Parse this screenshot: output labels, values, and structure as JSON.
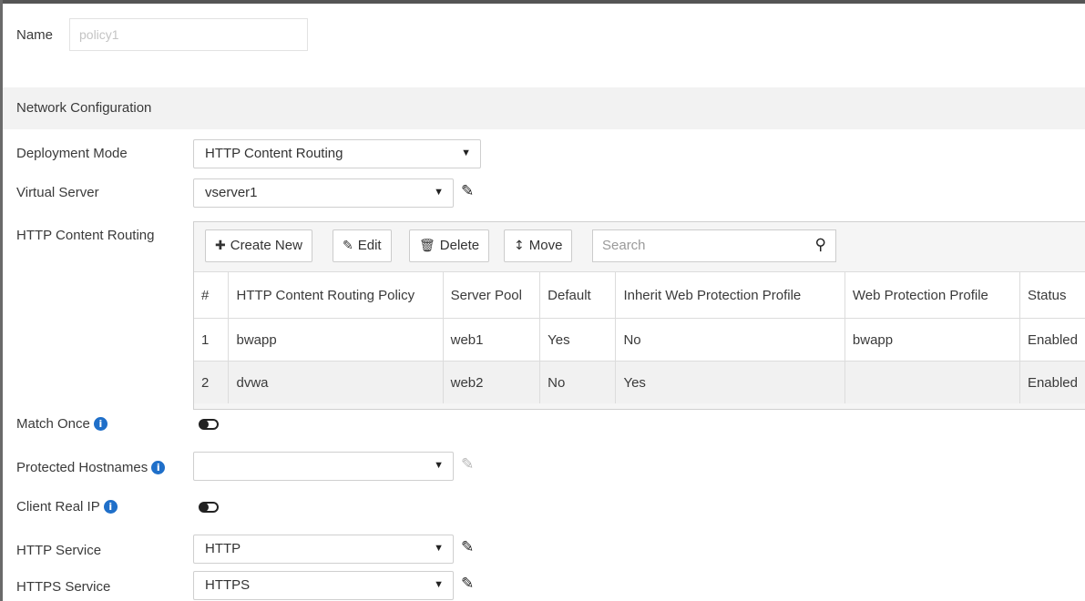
{
  "name": {
    "label": "Name",
    "value": "policy1"
  },
  "network_configuration": {
    "title": "Network Configuration"
  },
  "deployment_mode": {
    "label": "Deployment Mode",
    "value": "HTTP Content Routing"
  },
  "virtual_server": {
    "label": "Virtual Server",
    "value": "vserver1"
  },
  "http_content_routing": {
    "label": "HTTP Content Routing",
    "toolbar": {
      "create_new": "Create New",
      "edit": "Edit",
      "delete": "Delete",
      "move": "Move",
      "search_placeholder": "Search"
    },
    "columns": [
      "#",
      "HTTP Content Routing Policy",
      "Server Pool",
      "Default",
      "Inherit Web Protection Profile",
      "Web Protection Profile",
      "Status"
    ],
    "rows": [
      {
        "num": "1",
        "policy": "bwapp",
        "server_pool": "web1",
        "default": "Yes",
        "inherit": "No",
        "wpp": "bwapp",
        "status": "Enabled"
      },
      {
        "num": "2",
        "policy": "dvwa",
        "server_pool": "web2",
        "default": "No",
        "inherit": "Yes",
        "wpp": "",
        "status": "Enabled"
      }
    ]
  },
  "match_once": {
    "label": "Match Once",
    "enabled": false
  },
  "protected_hostnames": {
    "label": "Protected Hostnames",
    "value": ""
  },
  "client_real_ip": {
    "label": "Client Real IP",
    "enabled": false
  },
  "http_service": {
    "label": "HTTP Service",
    "value": "HTTP"
  },
  "https_service": {
    "label": "HTTPS Service",
    "value": "HTTPS"
  },
  "colors": {
    "info_icon": "#1f6fc9",
    "section_bg": "#f2f2f2",
    "panel_bg": "#f5f5f5"
  },
  "icons": [
    "plus-icon",
    "pencil-icon",
    "trash-icon",
    "move-icon",
    "search-icon",
    "info-icon",
    "caret-down-icon",
    "toggle-icon"
  ]
}
